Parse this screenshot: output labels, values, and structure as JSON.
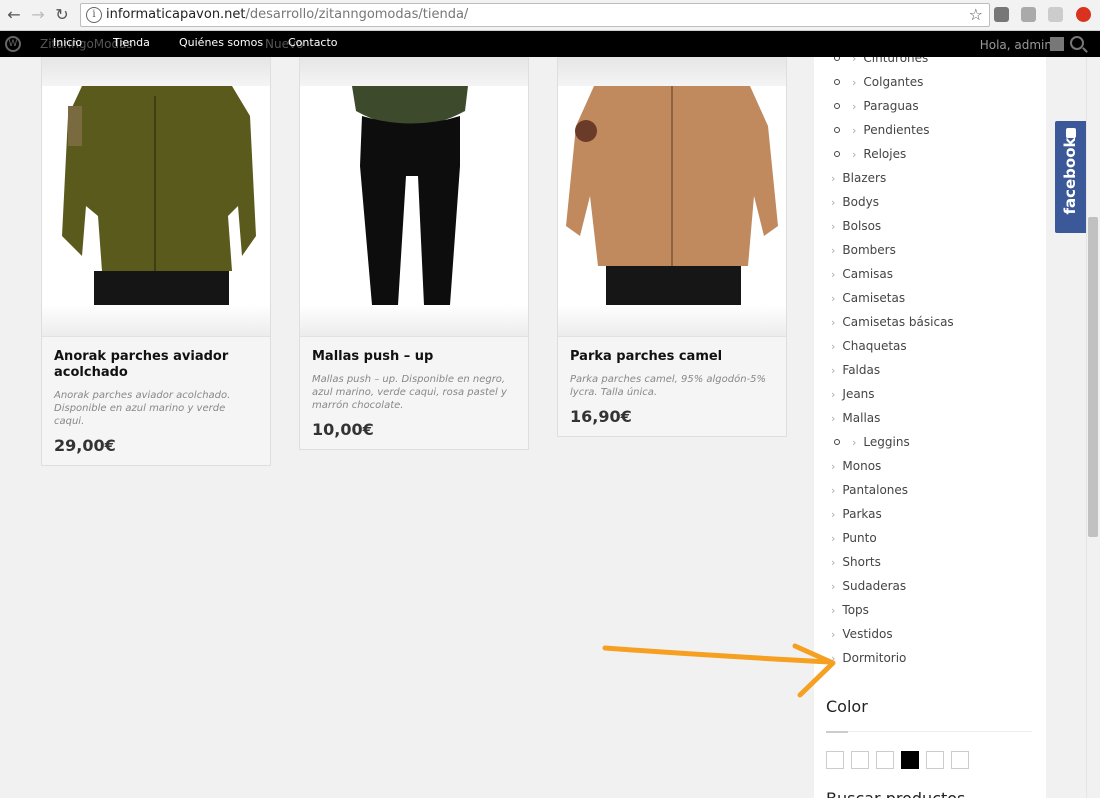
{
  "browser": {
    "url_domain": "informaticapavon.net",
    "url_path": "/desarrollo/zitanngomodas/tienda/"
  },
  "adminbar": {
    "site_ghost": "ZitanngoModas",
    "new_ghost": "Nuevo",
    "menu": [
      "Inicio",
      "Tienda",
      "Quiénes somos",
      "Contacto"
    ],
    "howdy": "Hola, admin"
  },
  "products": [
    {
      "title": "Anorak parches aviador acolchado",
      "desc": "Anorak parches aviador acolchado. Disponible en azul marino y verde caqui.",
      "price": "29,00€"
    },
    {
      "title": "Mallas push – up",
      "desc": "Mallas push – up. Disponible en negro, azul marino, verde caqui, rosa pastel y marrón chocolate.",
      "price": "10,00€"
    },
    {
      "title": "Parka parches camel",
      "desc": "Parka parches camel, 95% algodón-5% lycra. Talla única.",
      "price": "16,90€"
    }
  ],
  "sidebar": {
    "partial_top": "Cinturones",
    "subcats_top": [
      "Colgantes",
      "Paraguas",
      "Pendientes",
      "Relojes"
    ],
    "cats": [
      "Blazers",
      "Bodys",
      "Bolsos",
      "Bombers",
      "Camisas",
      "Camisetas",
      "Camisetas básicas",
      "Chaquetas",
      "Faldas",
      "Jeans",
      "Mallas"
    ],
    "subcat_mallas": "Leggins",
    "cats2": [
      "Monos",
      "Pantalones",
      "Parkas",
      "Punto",
      "Shorts",
      "Sudaderas",
      "Tops",
      "Vestidos",
      "Dormitorio"
    ],
    "color_title": "Color",
    "swatches": [
      "#ffffff",
      "#ffffff",
      "#ffffff",
      "#000000",
      "#ffffff",
      "#ffffff"
    ],
    "next_title_partial": "Buscar productos"
  },
  "facebook": {
    "label": "facebook"
  },
  "colors": {
    "fb_blue": "#3b5998",
    "arrow_orange": "#f5a020"
  }
}
